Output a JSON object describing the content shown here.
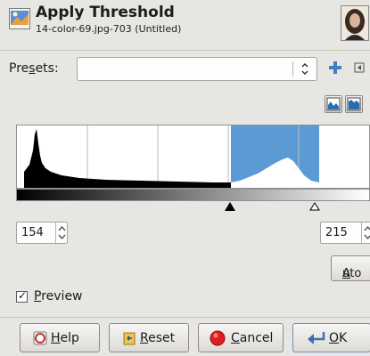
{
  "header": {
    "title": "Apply Threshold",
    "subtitle": "14-color-69.jpg-703 (Untitled)"
  },
  "presets": {
    "label_pre": "Pre",
    "label_mnemonic": "s",
    "label_post": "ets:",
    "value": ""
  },
  "threshold": {
    "low": "154",
    "high": "215"
  },
  "buttons": {
    "auto_mnemonic": "A",
    "auto_rest": "uto",
    "help_mnemonic": "H",
    "help_rest": "elp",
    "reset_mnemonic": "R",
    "reset_rest": "eset",
    "cancel_mnemonic": "C",
    "cancel_rest": "ancel",
    "ok_mnemonic": "O",
    "ok_rest": "K"
  },
  "preview": {
    "mnemonic": "P",
    "rest": "review",
    "checked": true,
    "check_glyph": "✓"
  },
  "colors": {
    "selection": "#5b9bd5",
    "background": "#e8e6e2"
  },
  "icons": {
    "header": "threshold-icon",
    "add": "plus-icon",
    "menu": "menu-arrow-icon",
    "linear": "linear-histogram-icon",
    "log": "log-histogram-icon",
    "help": "help-icon",
    "reset": "reset-icon",
    "cancel": "cancel-icon",
    "ok": "ok-icon"
  }
}
